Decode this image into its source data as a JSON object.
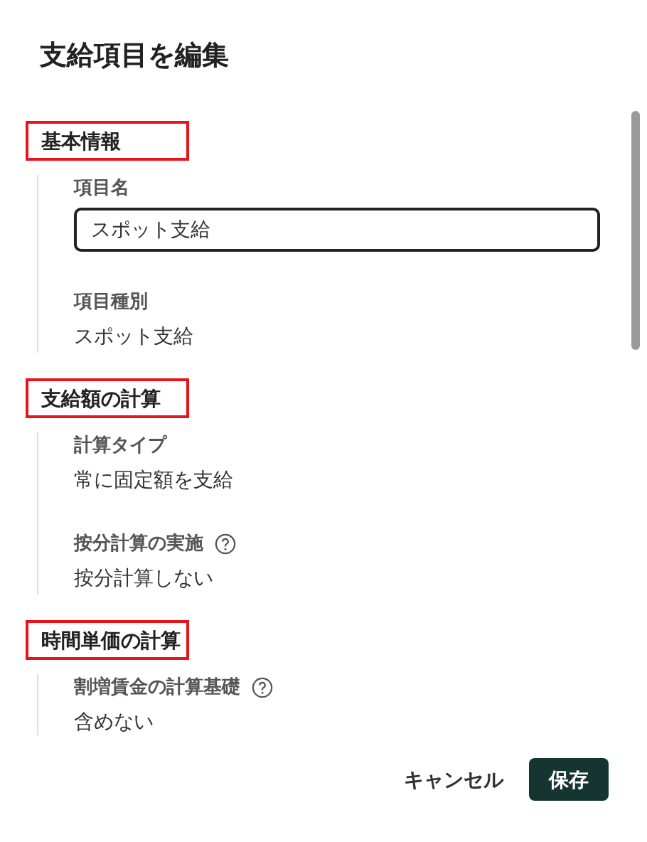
{
  "title": "支給項目を編集",
  "sections": [
    {
      "heading": "基本情報",
      "highlighted": true,
      "fields": [
        {
          "kind": "input",
          "label": "項目名",
          "value": "スポット支給",
          "help": false
        },
        {
          "kind": "text",
          "label": "項目種別",
          "value": "スポット支給",
          "help": false
        }
      ]
    },
    {
      "heading": "支給額の計算",
      "highlighted": true,
      "fields": [
        {
          "kind": "text",
          "label": "計算タイプ",
          "value": "常に固定額を支給",
          "help": false
        },
        {
          "kind": "text",
          "label": "按分計算の実施",
          "value": "按分計算しない",
          "help": true
        }
      ]
    },
    {
      "heading": "時間単価の計算",
      "highlighted": true,
      "fields": [
        {
          "kind": "text",
          "label": "割増賃金の計算基礎",
          "value": "含めない",
          "help": true
        }
      ]
    }
  ],
  "buttons": [
    {
      "kind": "secondary",
      "label": "キャンセル"
    },
    {
      "kind": "primary",
      "label": "保存"
    }
  ]
}
